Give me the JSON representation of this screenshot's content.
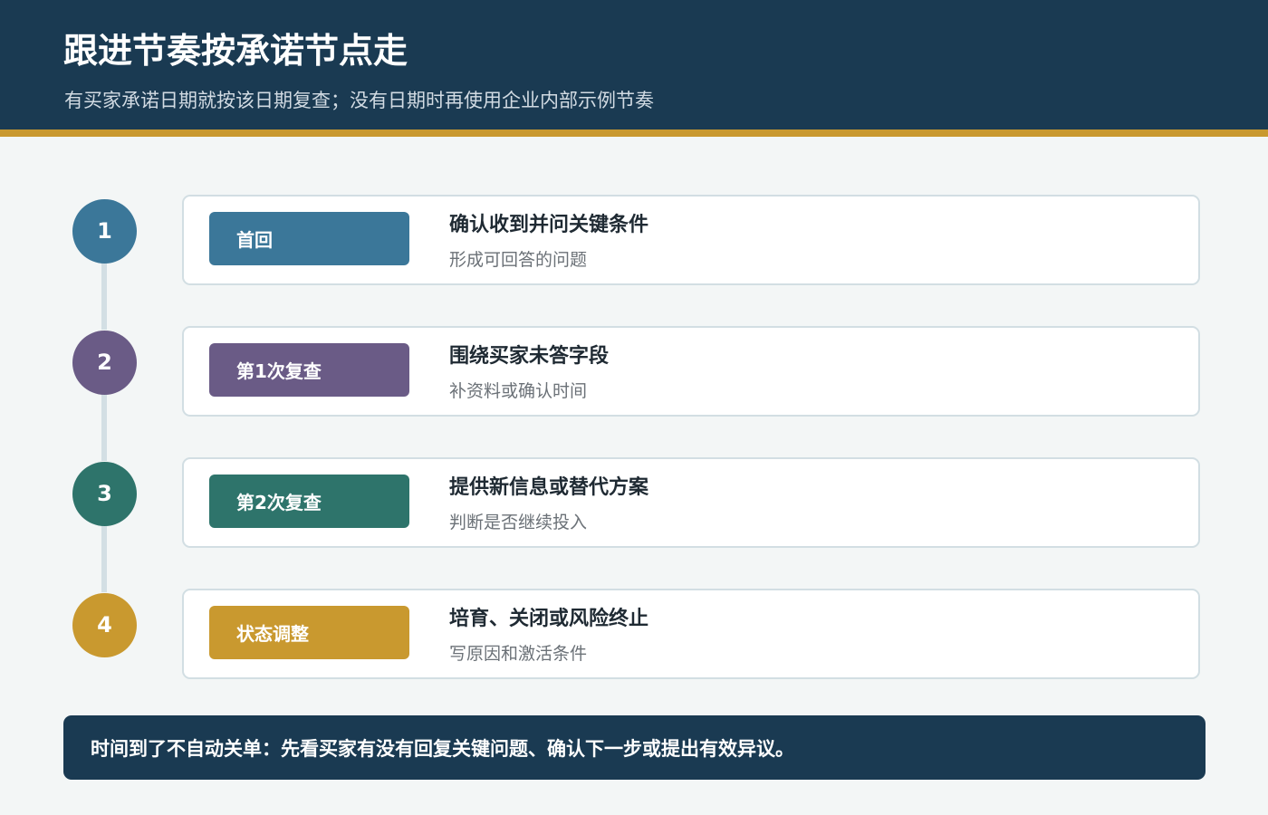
{
  "header": {
    "title": "跟进节奏按承诺节点走",
    "subtitle": "有买家承诺日期就按该日期复查；没有日期时再使用企业内部示例节奏"
  },
  "steps": [
    {
      "number": "1",
      "tag": "首回",
      "title": "确认收到并问关键条件",
      "desc": "形成可回答的问题"
    },
    {
      "number": "2",
      "tag": "第1次复查",
      "title": "围绕买家未答字段",
      "desc": "补资料或确认时间"
    },
    {
      "number": "3",
      "tag": "第2次复查",
      "title": "提供新信息或替代方案",
      "desc": "判断是否继续投入"
    },
    {
      "number": "4",
      "tag": "状态调整",
      "title": "培育、关闭或风险终止",
      "desc": "写原因和激活条件"
    }
  ],
  "footer": {
    "note": "时间到了不自动关单：先看买家有没有回复关键问题、确认下一步或提出有效异议。"
  },
  "colors": {
    "header_bg": "#1a3a52",
    "accent_gold": "#c9992f",
    "step1": "#3b7799",
    "step2": "#6a5b86",
    "step3": "#2e746b",
    "step4": "#c9992f"
  }
}
